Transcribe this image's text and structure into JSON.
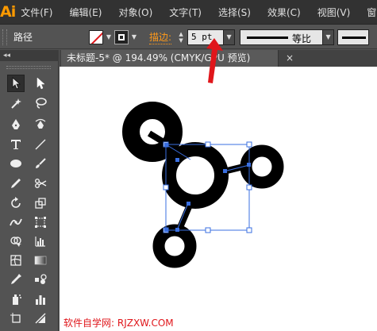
{
  "app": {
    "logo": "Ai"
  },
  "menu": {
    "items": [
      "文件(F)",
      "编辑(E)",
      "对象(O)",
      "文字(T)",
      "选择(S)",
      "效果(C)",
      "视图(V)",
      "窗口"
    ]
  },
  "control": {
    "selection_label": "路径",
    "stroke_label": "描边:",
    "stroke_weight": "5 pt",
    "profile_label": "等比"
  },
  "tools_header": "◂◂",
  "document": {
    "tab_title": "未标题-5* @ 194.49% (CMYK/GPU 预览)",
    "close": "×"
  },
  "watermark": "软件自学网: RJZXW.COM",
  "colors": {
    "accent": "#ff9a00",
    "annotation_arrow": "#e0161b",
    "selection": "#3a6fe0"
  },
  "icons": [
    "selection-tool-icon",
    "direct-selection-tool-icon",
    "magic-wand-icon",
    "lasso-icon",
    "pen-icon",
    "curvature-icon",
    "type-icon",
    "line-icon",
    "ellipse-icon",
    "paintbrush-icon",
    "pencil-icon",
    "scissors-icon",
    "rotate-icon",
    "scale-icon",
    "width-icon",
    "free-transform-icon",
    "shape-builder-icon",
    "chart-icon",
    "mesh-icon",
    "gradient-icon",
    "eyedropper-icon",
    "blend-icon",
    "symbol-sprayer-icon",
    "column-graph-icon",
    "artboard-icon",
    "slice-icon"
  ]
}
